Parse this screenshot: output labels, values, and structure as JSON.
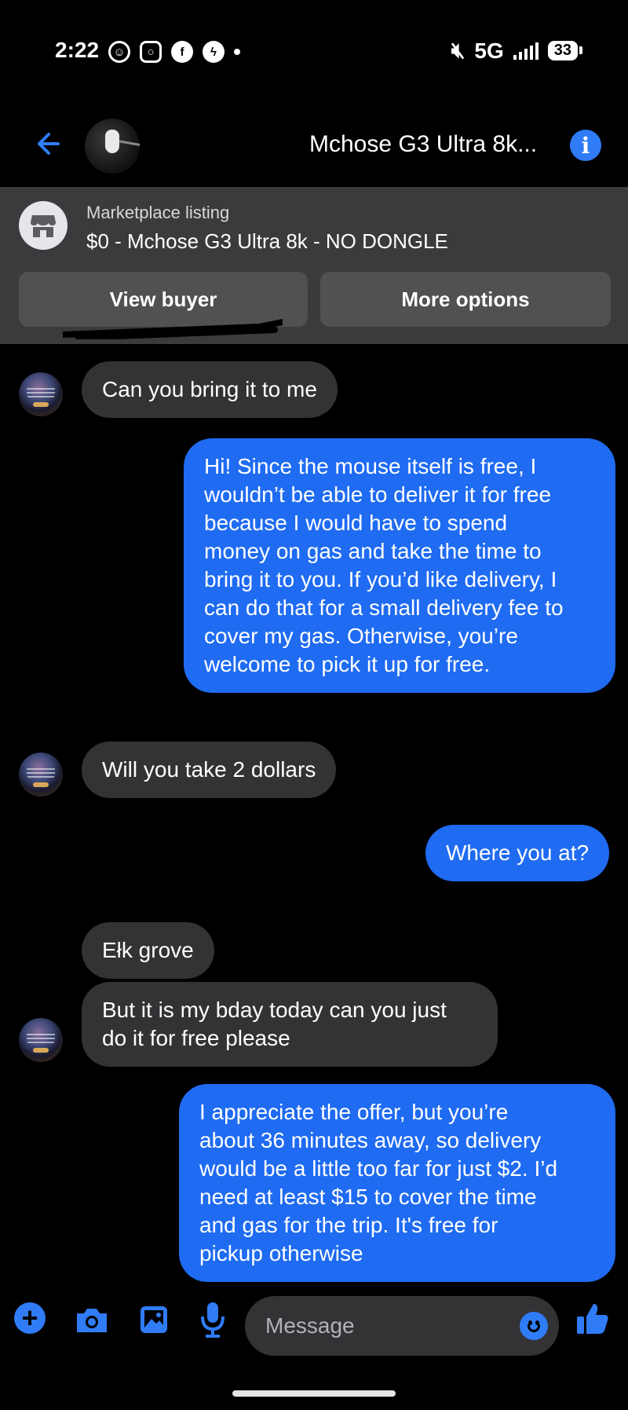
{
  "status_bar": {
    "time": "2:22",
    "network": "5G",
    "battery": "33",
    "icons": [
      "avatar-notification-icon",
      "instagram-icon",
      "facebook-icon",
      "messenger-icon",
      "dot-icon",
      "mute-icon",
      "signal-icon",
      "battery-icon"
    ]
  },
  "header": {
    "back_icon": "back-arrow-icon",
    "title": "Mchose G3 Ultra 8k...",
    "info_icon": "info-icon"
  },
  "listing": {
    "kicker": "Marketplace listing",
    "name": "$0 - Mchose G3 Ultra 8k - NO DONGLE",
    "view_buyer": "View buyer",
    "more_options": "More options"
  },
  "messages": [
    {
      "from": "them",
      "text": "Can you bring it to me"
    },
    {
      "from": "me",
      "lines": [
        "Hi! Since the mouse itself is free, I",
        "wouldn’t be able to deliver it for free",
        "because I would have to spend",
        "money on gas and take the time to",
        "bring it to you. If you’d like delivery, I",
        "can do that for a small delivery fee to",
        "cover my gas. Otherwise, you’re",
        "welcome to pick it up for free."
      ]
    },
    {
      "from": "them",
      "text": "Will you take 2 dollars"
    },
    {
      "from": "me",
      "text": "Where you at?"
    },
    {
      "from": "them",
      "text": "Ełk grove"
    },
    {
      "from": "them",
      "lines": [
        "But it is my bday today can you just",
        "do it for free please"
      ]
    },
    {
      "from": "me",
      "lines": [
        "I appreciate the offer, but you’re",
        "about 36 minutes away, so delivery",
        "would be a little too far for just $2. I’d",
        "need at least $15 to cover the time",
        "and gas for the trip. It's free for",
        "pickup otherwise"
      ]
    }
  ],
  "composer": {
    "placeholder": "Message",
    "icons": [
      "plus-icon",
      "camera-icon",
      "gallery-icon",
      "microphone-icon",
      "emoji-icon",
      "like-icon"
    ]
  },
  "colors": {
    "accent": "#2f7cf6",
    "outgoing_bubble": "#1f6bf2",
    "incoming_bubble": "#333336",
    "panel": "#3b3b3d"
  }
}
